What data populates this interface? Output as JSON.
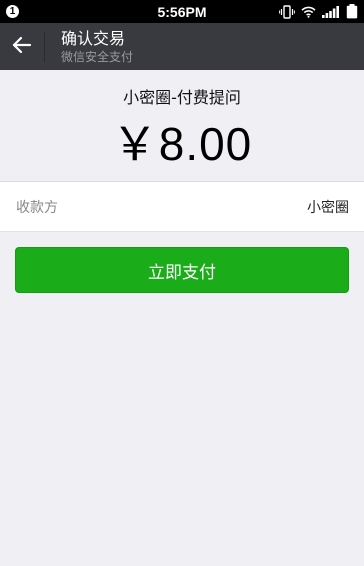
{
  "status_bar": {
    "notification_count": "1",
    "time": "5:56PM",
    "icons": [
      "vibrate-icon",
      "wifi-icon",
      "signal-icon",
      "battery-icon"
    ]
  },
  "nav": {
    "back_icon": "back-arrow-icon",
    "title": "确认交易",
    "subtitle": "微信安全支付"
  },
  "payment": {
    "description": "小密圈-付费提问",
    "amount": "￥8.00"
  },
  "payee": {
    "label": "收款方",
    "value": "小密圈"
  },
  "actions": {
    "pay_button_label": "立即支付"
  },
  "colors": {
    "nav_bg": "#393a3f",
    "page_bg": "#efeff4",
    "pay_button": "#1aad19"
  }
}
